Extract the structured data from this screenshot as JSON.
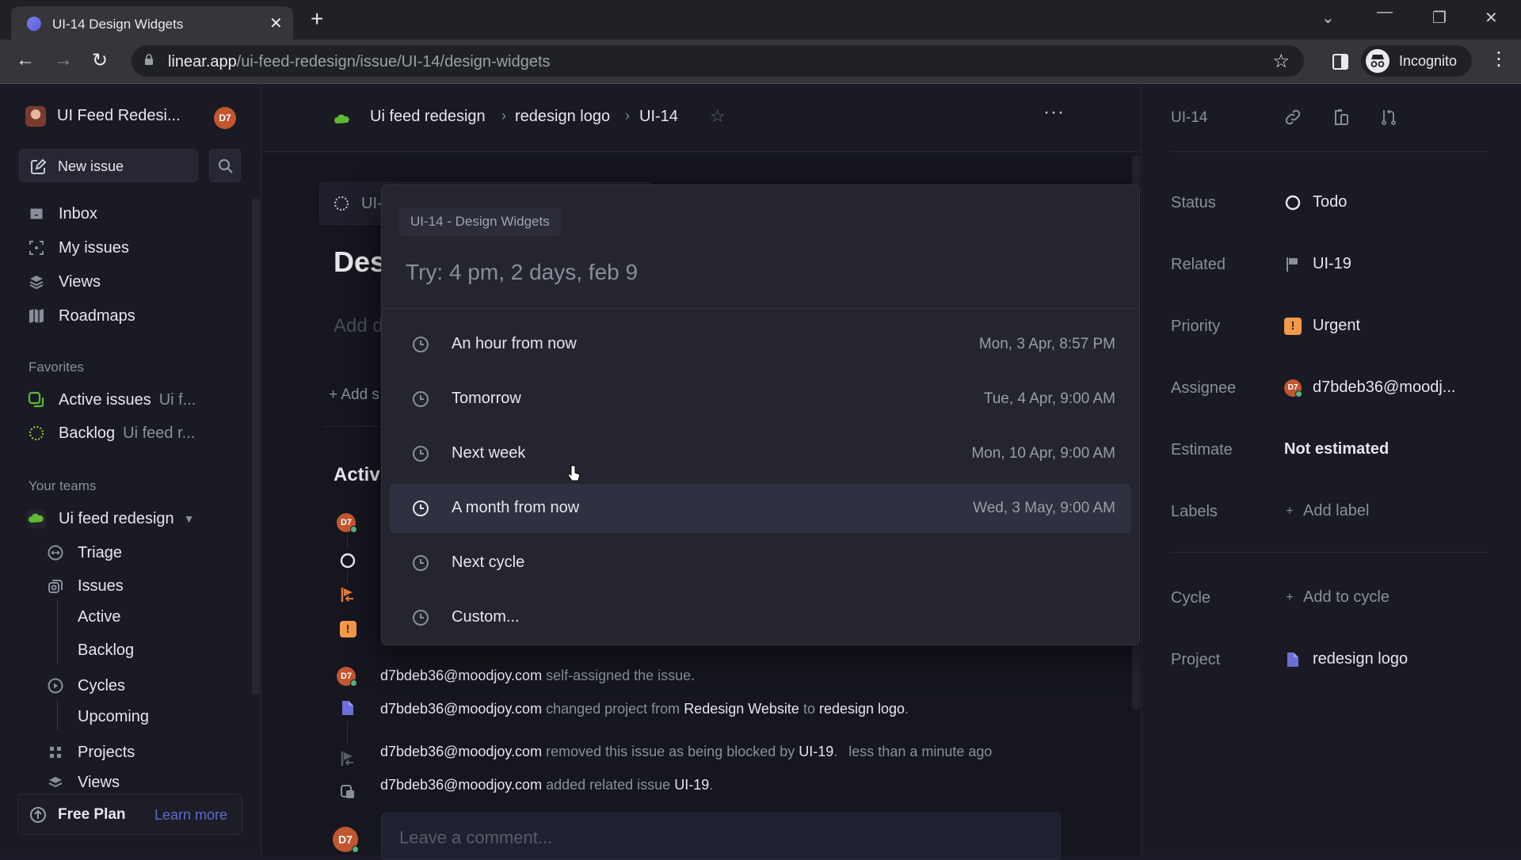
{
  "browser": {
    "tab_title": "UI-14 Design Widgets",
    "url_host": "linear.app",
    "url_path": "/ui-feed-redesign/issue/UI-14/design-widgets",
    "profile_label": "Incognito"
  },
  "sidebar": {
    "workspace_name": "UI Feed Redesi...",
    "user_initials": "D7",
    "new_issue_label": "New issue",
    "nav": [
      {
        "label": "Inbox",
        "icon": "inbox-icon"
      },
      {
        "label": "My issues",
        "icon": "my-issues-icon"
      },
      {
        "label": "Views",
        "icon": "views-icon"
      },
      {
        "label": "Roadmaps",
        "icon": "roadmaps-icon"
      }
    ],
    "favorites_heading": "Favorites",
    "favorites": [
      {
        "label": "Active issues",
        "sub": "Ui f..."
      },
      {
        "label": "Backlog",
        "sub": "Ui feed r..."
      }
    ],
    "teams_heading": "Your teams",
    "team_name": "Ui feed redesign",
    "team_items": {
      "triage": "Triage",
      "issues": "Issues",
      "active": "Active",
      "backlog": "Backlog",
      "cycles": "Cycles",
      "upcoming": "Upcoming",
      "projects": "Projects",
      "views": "Views"
    },
    "plan_label": "Free Plan",
    "learn_more": "Learn more"
  },
  "main": {
    "breadcrumb": [
      "Ui feed redesign",
      "redesign logo",
      "UI-14"
    ],
    "id_chip": "UI-",
    "title_partial": "Des",
    "add_description_partial": "Add d",
    "add_subissue_partial": "+ Add s",
    "activity_heading_partial": "Activi",
    "activity": [
      {
        "user": "d7bdeb36@moodjoy.com",
        "parts": [
          {
            "text": " self-assigned the issue.",
            "bold": false
          }
        ],
        "time": ""
      },
      {
        "user": "d7bdeb36@moodjoy.com",
        "parts": [
          {
            "text": " changed project from ",
            "bold": false
          },
          {
            "text": "Redesign Website",
            "bold": true
          },
          {
            "text": " to ",
            "bold": false
          },
          {
            "text": "redesign logo",
            "bold": true
          },
          {
            "text": ".",
            "bold": false
          }
        ],
        "time": ""
      },
      {
        "user": "d7bdeb36@moodjoy.com",
        "parts": [
          {
            "text": " removed this issue as being blocked by ",
            "bold": false
          },
          {
            "text": "UI-19",
            "bold": true
          },
          {
            "text": ".",
            "bold": false
          }
        ],
        "time": "less than a minute ago"
      },
      {
        "user": "d7bdeb36@moodjoy.com",
        "parts": [
          {
            "text": " added related issue ",
            "bold": false
          },
          {
            "text": "UI-19",
            "bold": true
          },
          {
            "text": ".",
            "bold": false
          }
        ],
        "time": ""
      }
    ],
    "comment_placeholder": "Leave a comment..."
  },
  "popover": {
    "context_chip": "UI-14 - Design Widgets",
    "input_placeholder": "Try: 4 pm, 2 days, feb 9",
    "options": [
      {
        "label": "An hour from now",
        "date": "Mon, 3 Apr, 8:57 PM",
        "highlighted": false
      },
      {
        "label": "Tomorrow",
        "date": "Tue, 4 Apr, 9:00 AM",
        "highlighted": false
      },
      {
        "label": "Next week",
        "date": "Mon, 10 Apr, 9:00 AM",
        "highlighted": false
      },
      {
        "label": "A month from now",
        "date": "Wed, 3 May, 9:00 AM",
        "highlighted": true
      },
      {
        "label": "Next cycle",
        "date": "",
        "highlighted": false
      },
      {
        "label": "Custom...",
        "date": "",
        "highlighted": false
      }
    ]
  },
  "details": {
    "issue_id": "UI-14",
    "rows": [
      {
        "label": "Status",
        "value": "Todo",
        "icon": "todo-circle-icon"
      },
      {
        "label": "Related",
        "value": "UI-19",
        "icon": "flag-icon"
      },
      {
        "label": "Priority",
        "value": "Urgent",
        "icon": "urgent-priority-icon"
      },
      {
        "label": "Assignee",
        "value": "d7bdeb36@moodj...",
        "icon": "avatar-icon"
      },
      {
        "label": "Estimate",
        "value": "Not estimated",
        "icon": ""
      },
      {
        "label": "Labels",
        "value": "Add label",
        "icon": "plus-icon"
      },
      {
        "label": "Cycle",
        "value": "Add to cycle",
        "icon": "plus-icon"
      },
      {
        "label": "Project",
        "value": "redesign logo",
        "icon": "project-icon"
      }
    ]
  },
  "colors": {
    "accent": "#5e6ad2",
    "team_green": "#5fb832",
    "urgent_orange": "#f2994a",
    "avatar_orange": "#c2562f",
    "online_green": "#4cb782"
  }
}
